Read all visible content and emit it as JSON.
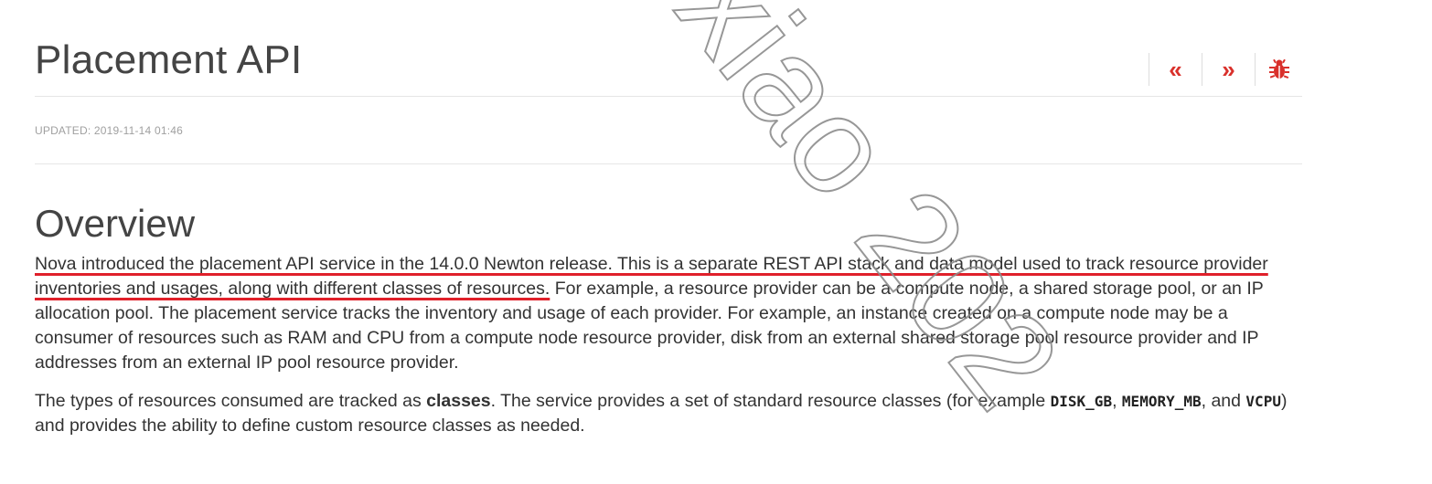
{
  "header": {
    "title": "Placement API",
    "nav": {
      "prev_glyph": "«",
      "next_glyph": "»",
      "bug_glyph": "🐞"
    }
  },
  "meta": {
    "updated": "UPDATED: 2019-11-14 01:46"
  },
  "content": {
    "section_heading": "Overview",
    "p1": {
      "underlined": "Nova introduced the placement API service in the 14.0.0 Newton release. This is a separate REST API stack and data model used to track resource provider inventories and usages, along with different classes of resources.",
      "rest": " For example, a resource provider can be a compute node, a shared storage pool, or an IP allocation pool. The placement service tracks the inventory and usage of each provider. For example, an instance created on a compute node may be a consumer of resources such as RAM and CPU from a compute node resource provider, disk from an external shared storage pool resource provider and IP addresses from an external IP pool resource provider."
    },
    "p2": {
      "t1": "The types of resources consumed are tracked as ",
      "b1": "classes",
      "t2": ". The service provides a set of standard resource classes (for example ",
      "c1": "DISK_GB",
      "t3": ", ",
      "c2": "MEMORY_MB",
      "t4": ", and ",
      "c3": "VCPU",
      "t5": ") and provides the ability to define custom resource classes as needed."
    }
  },
  "watermark": {
    "text": "xiao 202",
    "color": "#8c8c8c"
  },
  "colors": {
    "accent": "#d9302b",
    "underline": "#e0202a"
  }
}
